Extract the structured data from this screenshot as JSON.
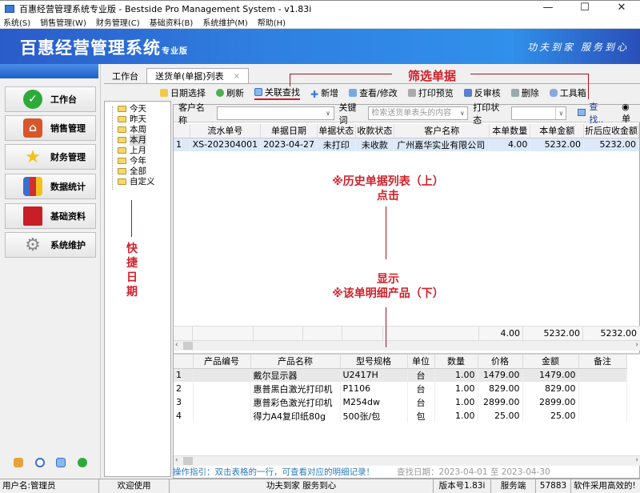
{
  "window": {
    "title": "百惠经营管理系统专业版 - Bestside Pro Management System - v1.83i",
    "minimize": "—",
    "maximize": "☐",
    "close": "✕"
  },
  "menu": [
    "系统(S)",
    "销售管理(W)",
    "财务管理(C)",
    "基础资料(B)",
    "系统维护(M)",
    "帮助(H)"
  ],
  "banner": {
    "brand": "百惠经营管理系统",
    "edition": "专业版",
    "slogan": "功夫到家 服务到心"
  },
  "nav": [
    {
      "label": "工作台",
      "icon": "check-circle-icon",
      "color": "#2eaa3a"
    },
    {
      "label": "销售管理",
      "icon": "house-icon",
      "color": "#d8572a"
    },
    {
      "label": "财务管理",
      "icon": "star-icon",
      "color": "#f2c21a"
    },
    {
      "label": "数据统计",
      "icon": "bar-chart-icon",
      "color": "#3a6fd0"
    },
    {
      "label": "基础资料",
      "icon": "book-icon",
      "color": "#c81e26"
    },
    {
      "label": "系统维护",
      "icon": "gear-icon",
      "color": "#888888"
    }
  ],
  "tabs": {
    "home": "工作台",
    "active": "送货单(单据)列表",
    "close": "×"
  },
  "toolbar": [
    "日期选择",
    "刷新",
    "关联查找",
    "新增",
    "查看/修改",
    "打印预览",
    "反审核",
    "删除",
    "工具箱"
  ],
  "tree": [
    "今天",
    "昨天",
    "本周",
    "本月",
    "上月",
    "今年",
    "全部",
    "自定义"
  ],
  "tree_selected": "本月",
  "filter": {
    "customer_label": "客户名称",
    "customer_value": "",
    "keyword_label": "关键词",
    "keyword_placeholder": "检索送货单表头的内容",
    "print_label": "打印状态",
    "print_value": "",
    "search_label": "查找..",
    "radio_label": "单"
  },
  "orders": {
    "headers": [
      "",
      "流水单号",
      "单据日期",
      "单据状态",
      "收款状态",
      "客户名称",
      "本单数量",
      "本单金额",
      "折后应收金额"
    ],
    "rows": [
      [
        "1",
        "XS-202304001",
        "2023-04-27",
        "未打印",
        "未收款",
        "广州嘉华实业有限公司",
        "4.00",
        "5232.00",
        "5232.00"
      ]
    ],
    "totals": {
      "qty": "4.00",
      "amount": "5232.00",
      "receivable": "5232.00"
    }
  },
  "details": {
    "headers": [
      "",
      "产品编号",
      "产品名称",
      "型号规格",
      "单位",
      "数量",
      "价格",
      "金额",
      "备注"
    ],
    "rows": [
      [
        "1",
        "",
        "戴尔显示器",
        "U2417H",
        "台",
        "1.00",
        "1479.00",
        "1479.00",
        ""
      ],
      [
        "2",
        "",
        "惠普黑白激光打印机",
        "P1106",
        "台",
        "1.00",
        "829.00",
        "829.00",
        ""
      ],
      [
        "3",
        "",
        "惠普彩色激光打印机",
        "M254dw",
        "台",
        "1.00",
        "2899.00",
        "2899.00",
        ""
      ],
      [
        "4",
        "",
        "得力A4复印纸80g",
        "500张/包",
        "包",
        "1.00",
        "25.00",
        "25.00",
        ""
      ]
    ]
  },
  "guide": "操作指引：双击表格的一行，可查看对应的明细记录！",
  "search_date": "查找日期：2023-04-01 至 2023-04-30",
  "status": [
    "用户名:管理员",
    "欢迎使用",
    "功夫到家 服务到心",
    "版本号1.83i",
    "服务端",
    "57883",
    "软件采用高效的!"
  ],
  "annotations": {
    "filter": "筛选单据",
    "quick_dates": "快\n捷\n日\n期",
    "history_line1": "※历史单据列表（上）",
    "history_line2": "点击",
    "show_line1": "显示",
    "show_line2": "※该单明细产品（下）"
  }
}
